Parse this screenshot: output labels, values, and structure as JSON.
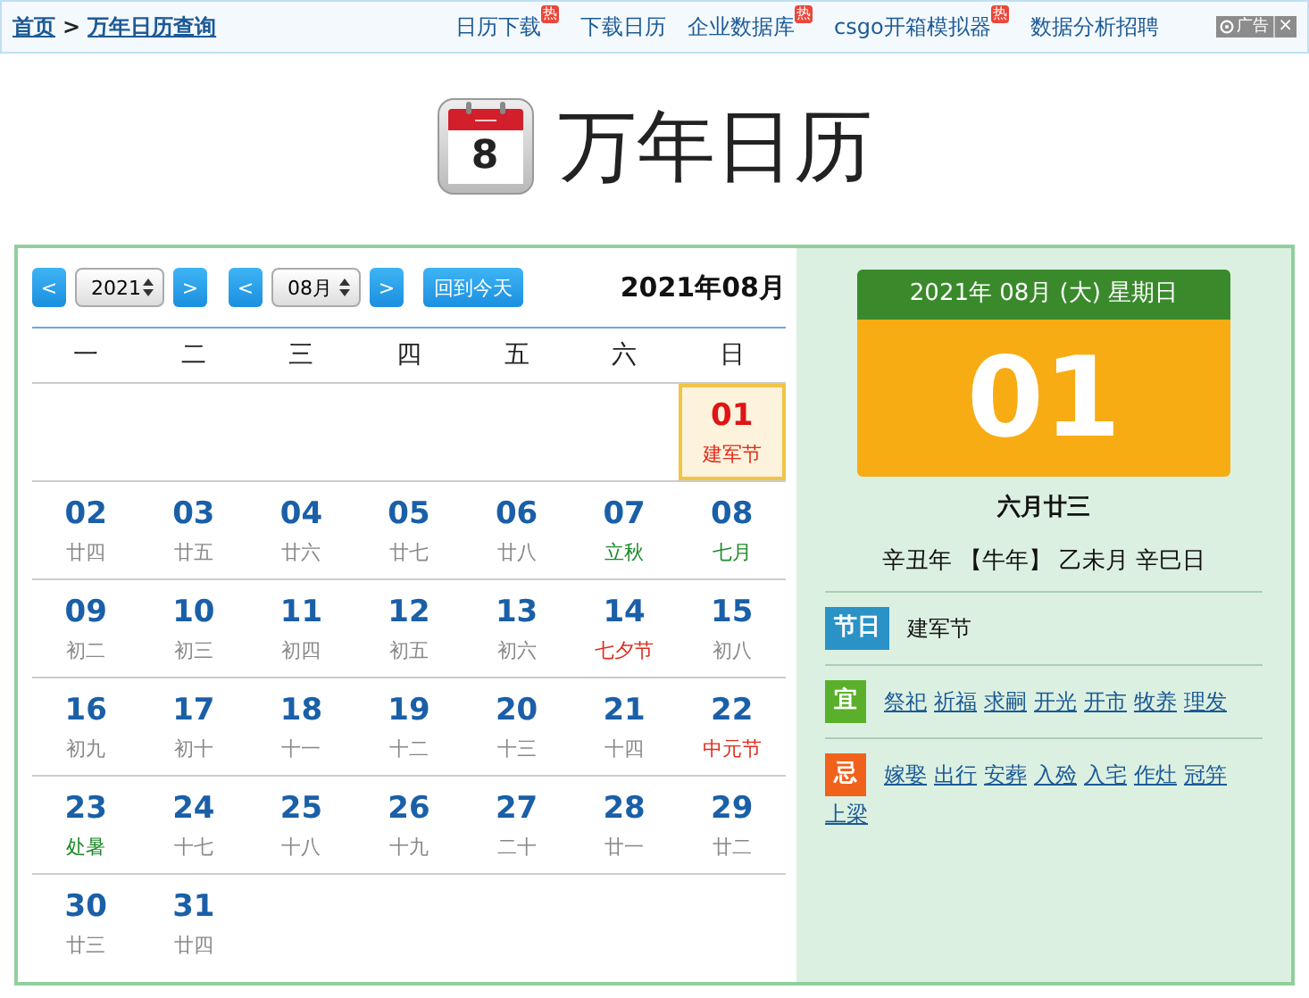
{
  "breadcrumb": {
    "home": "首页",
    "separator": ">",
    "current": "万年日历查询"
  },
  "nav_links": [
    {
      "label": "日历下载",
      "badge": "热"
    },
    {
      "label": "下载日历"
    },
    {
      "label": "企业数据库",
      "badge": "热"
    },
    {
      "label": "csgo开箱模拟器",
      "badge": "热"
    },
    {
      "label": "数据分析招聘"
    }
  ],
  "ad": {
    "label": "广告",
    "close": "×"
  },
  "header": {
    "title": "万年日历",
    "icon_digit": "8"
  },
  "controls": {
    "prev_year": "<",
    "year": "2021",
    "next_year": ">",
    "prev_month": "<",
    "month": "08月",
    "next_month": ">",
    "today_button": "回到今天",
    "current": "2021年08月"
  },
  "weekdays": [
    "一",
    "二",
    "三",
    "四",
    "五",
    "六",
    "日"
  ],
  "weeks": [
    [
      {
        "kind": "blank"
      },
      {
        "kind": "blank"
      },
      {
        "kind": "blank"
      },
      {
        "kind": "blank"
      },
      {
        "kind": "blank"
      },
      {
        "kind": "blank"
      },
      {
        "kind": "day",
        "day": "01",
        "lunar": "建军节",
        "color": "#e02b1c",
        "selected": true
      }
    ],
    [
      {
        "kind": "day",
        "day": "02",
        "lunar": "廿四",
        "color": "#888888",
        "selected": false
      },
      {
        "kind": "day",
        "day": "03",
        "lunar": "廿五",
        "color": "#888888",
        "selected": false
      },
      {
        "kind": "day",
        "day": "04",
        "lunar": "廿六",
        "color": "#888888",
        "selected": false
      },
      {
        "kind": "day",
        "day": "05",
        "lunar": "廿七",
        "color": "#888888",
        "selected": false
      },
      {
        "kind": "day",
        "day": "06",
        "lunar": "廿八",
        "color": "#888888",
        "selected": false
      },
      {
        "kind": "day",
        "day": "07",
        "lunar": "立秋",
        "color": "#1f8a2a",
        "selected": false
      },
      {
        "kind": "day",
        "day": "08",
        "lunar": "七月",
        "color": "#1f8a2a",
        "selected": false
      }
    ],
    [
      {
        "kind": "day",
        "day": "09",
        "lunar": "初二",
        "color": "#888888",
        "selected": false
      },
      {
        "kind": "day",
        "day": "10",
        "lunar": "初三",
        "color": "#888888",
        "selected": false
      },
      {
        "kind": "day",
        "day": "11",
        "lunar": "初四",
        "color": "#888888",
        "selected": false
      },
      {
        "kind": "day",
        "day": "12",
        "lunar": "初五",
        "color": "#888888",
        "selected": false
      },
      {
        "kind": "day",
        "day": "13",
        "lunar": "初六",
        "color": "#888888",
        "selected": false
      },
      {
        "kind": "day",
        "day": "14",
        "lunar": "七夕节",
        "color": "#e02b1c",
        "selected": false
      },
      {
        "kind": "day",
        "day": "15",
        "lunar": "初八",
        "color": "#888888",
        "selected": false
      }
    ],
    [
      {
        "kind": "day",
        "day": "16",
        "lunar": "初九",
        "color": "#888888",
        "selected": false
      },
      {
        "kind": "day",
        "day": "17",
        "lunar": "初十",
        "color": "#888888",
        "selected": false
      },
      {
        "kind": "day",
        "day": "18",
        "lunar": "十一",
        "color": "#888888",
        "selected": false
      },
      {
        "kind": "day",
        "day": "19",
        "lunar": "十二",
        "color": "#888888",
        "selected": false
      },
      {
        "kind": "day",
        "day": "20",
        "lunar": "十三",
        "color": "#888888",
        "selected": false
      },
      {
        "kind": "day",
        "day": "21",
        "lunar": "十四",
        "color": "#888888",
        "selected": false
      },
      {
        "kind": "day",
        "day": "22",
        "lunar": "中元节",
        "color": "#e02b1c",
        "selected": false
      }
    ],
    [
      {
        "kind": "day",
        "day": "23",
        "lunar": "处暑",
        "color": "#1f8a2a",
        "selected": false
      },
      {
        "kind": "day",
        "day": "24",
        "lunar": "十七",
        "color": "#888888",
        "selected": false
      },
      {
        "kind": "day",
        "day": "25",
        "lunar": "十八",
        "color": "#888888",
        "selected": false
      },
      {
        "kind": "day",
        "day": "26",
        "lunar": "十九",
        "color": "#888888",
        "selected": false
      },
      {
        "kind": "day",
        "day": "27",
        "lunar": "二十",
        "color": "#888888",
        "selected": false
      },
      {
        "kind": "day",
        "day": "28",
        "lunar": "廿一",
        "color": "#888888",
        "selected": false
      },
      {
        "kind": "day",
        "day": "29",
        "lunar": "廿二",
        "color": "#888888",
        "selected": false
      }
    ],
    [
      {
        "kind": "day",
        "day": "30",
        "lunar": "廿三",
        "color": "#888888",
        "selected": false
      },
      {
        "kind": "day",
        "day": "31",
        "lunar": "廿四",
        "color": "#888888",
        "selected": false
      },
      {
        "kind": "blank"
      },
      {
        "kind": "blank"
      },
      {
        "kind": "blank"
      },
      {
        "kind": "blank"
      },
      {
        "kind": "blank"
      }
    ]
  ],
  "detail": {
    "date_line": "2021年 08月 (大) 星期日",
    "day": "01",
    "lunar_date": "六月廿三",
    "ganzhi": "辛丑年 【牛年】 乙未月 辛巳日",
    "sections": [
      {
        "kind": "festival",
        "badge": "节日",
        "color": "#2a92c6",
        "items": [
          "建军节"
        ]
      },
      {
        "kind": "good",
        "badge": "宜",
        "color": "#5ab02a",
        "items": [
          "祭祀",
          "祈福",
          "求嗣",
          "开光",
          "开市",
          "牧养",
          "理发"
        ]
      },
      {
        "kind": "bad",
        "badge": "忌",
        "color": "#f0621c",
        "items": [
          "嫁娶",
          "出行",
          "安葬",
          "入殓",
          "入宅",
          "作灶",
          "冠笄",
          "上梁"
        ]
      }
    ]
  }
}
